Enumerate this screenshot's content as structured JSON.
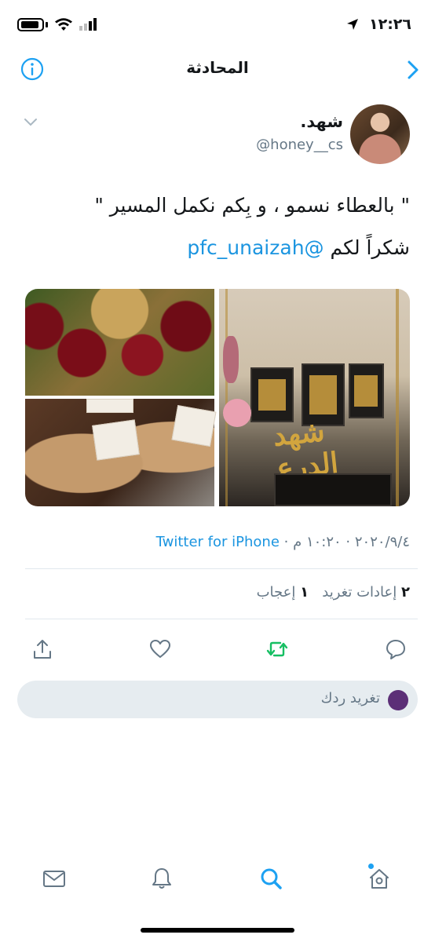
{
  "status_bar": {
    "time": "١٢:٢٦"
  },
  "nav": {
    "title": "المحادثة"
  },
  "tweet": {
    "display_name": "شهد.",
    "handle": "@honey__cs",
    "text_line1": "\" بالعطاء نسمو ، و بِكم نكمل المسير \"",
    "text_line2_prefix": "شكراً لكم ",
    "mention": "@pfc_unaizah",
    "media_caption": "شهد الدرع",
    "meta_date": "٢٠٢٠/٩/٤ · ١٠:٢٠ م · ",
    "meta_source": "Twitter for iPhone",
    "retweets_count": "٢",
    "retweets_label": "إعادات تغريد",
    "likes_count": "١",
    "likes_label": "إعجاب"
  },
  "actions": {
    "reply": "reply-icon",
    "retweet": "retweet-icon",
    "like": "heart-icon",
    "share": "share-icon",
    "retweet_color": "#17bf63"
  },
  "reply_bar": {
    "placeholder": "تغريد ردك"
  },
  "tabs": [
    "home-icon",
    "search-icon",
    "notifications-icon",
    "messages-icon"
  ],
  "colors": {
    "accent": "#1da1f2",
    "link": "#1b95e0",
    "muted": "#657786"
  }
}
